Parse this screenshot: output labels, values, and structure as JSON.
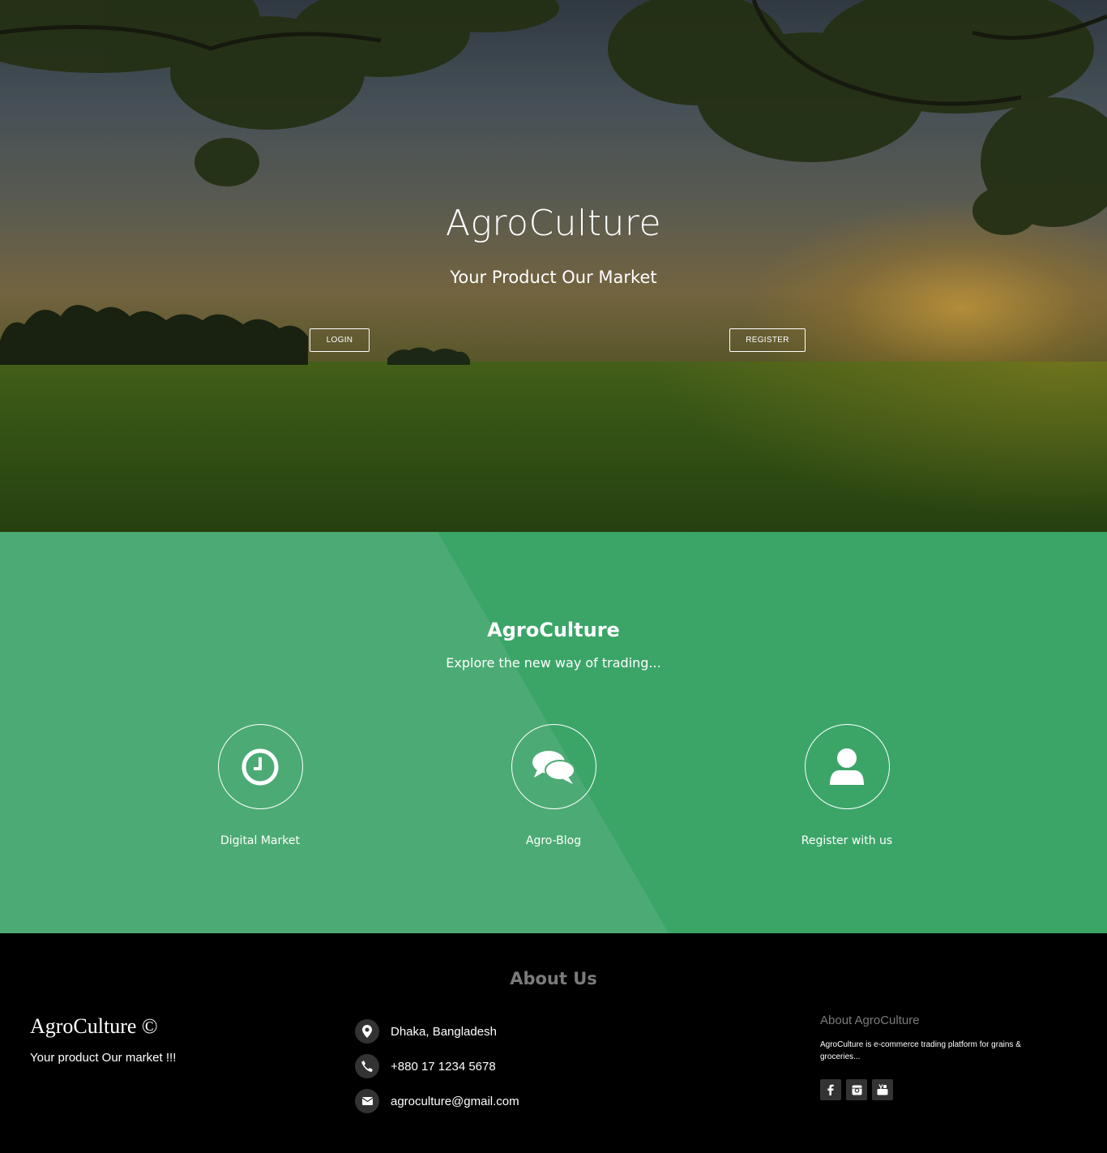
{
  "hero": {
    "title": "AgroCulture",
    "subtitle": "Your Product Our Market",
    "login_label": "LOGIN",
    "register_label": "REGISTER"
  },
  "features": {
    "title": "AgroCulture",
    "subtitle": "Explore the new way of trading...",
    "items": [
      {
        "label": "Digital Market",
        "icon": "clock-icon"
      },
      {
        "label": "Agro-Blog",
        "icon": "chat-bubbles-icon"
      },
      {
        "label": "Register with us",
        "icon": "user-icon"
      }
    ]
  },
  "footer": {
    "about_title": "About Us",
    "brand": "AgroCulture ©",
    "brand_tagline": "Your product Our market !!!",
    "contacts": [
      {
        "icon": "map-marker-icon",
        "text": "Dhaka, Bangladesh"
      },
      {
        "icon": "phone-icon",
        "text": "+880 17 1234 5678"
      },
      {
        "icon": "envelope-icon",
        "text": "agroculture@gmail.com"
      }
    ],
    "about_heading": "About AgroCulture",
    "about_text": "AgroCulture is e-commerce trading platform for grains & groceries...",
    "socials": [
      "facebook-icon",
      "instagram-icon",
      "youtube-icon"
    ]
  },
  "colors": {
    "green_primary": "#3ba568",
    "green_light": "#4cab74",
    "footer_bg": "#000000",
    "muted_text": "#7b7b7b"
  }
}
